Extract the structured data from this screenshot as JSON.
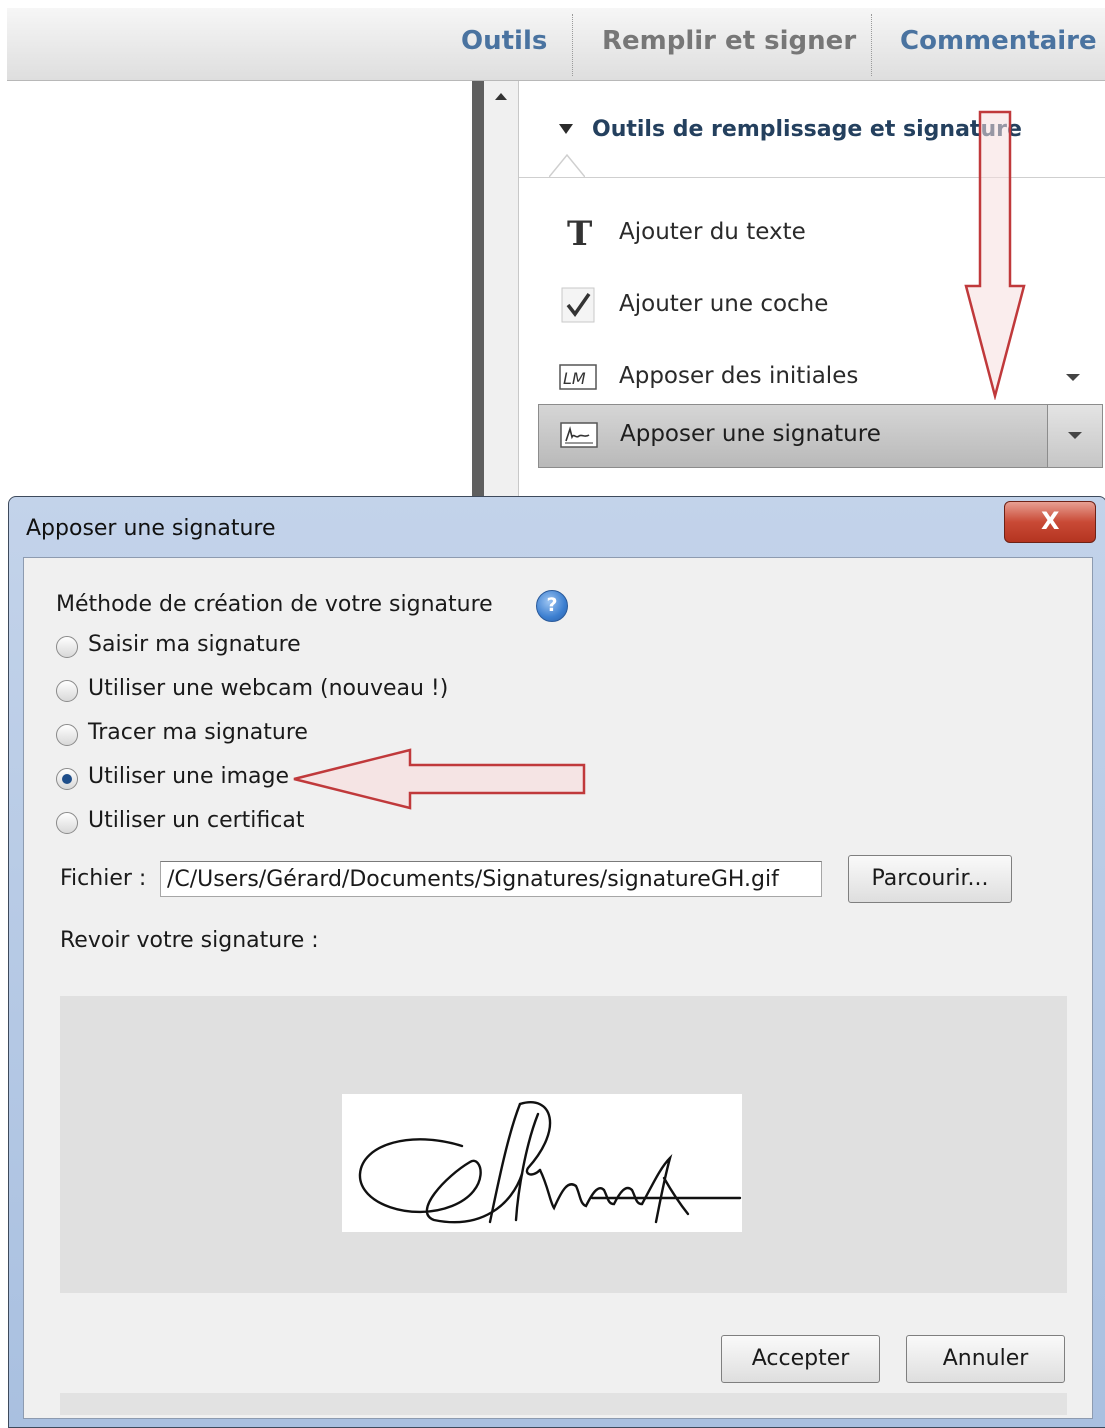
{
  "toolbar": {
    "tabs": [
      {
        "label": "Outils",
        "color": "#4a73a0"
      },
      {
        "label": "Remplir et signer",
        "color": "#777777"
      },
      {
        "label": "Commentaire",
        "color": "#4a73a0"
      }
    ]
  },
  "panel": {
    "section_title": "Outils de remplissage et signature",
    "tools": [
      {
        "label": "Ajouter du texte",
        "icon": "text-T-icon"
      },
      {
        "label": "Ajouter une coche",
        "icon": "checkmark-icon"
      },
      {
        "label": "Apposer des initiales",
        "icon": "initials-icon",
        "initials": "LM"
      },
      {
        "label": "Apposer une signature",
        "icon": "signature-pen-icon",
        "selected": true
      }
    ]
  },
  "dialog": {
    "title": "Apposer une signature",
    "close_glyph": "X",
    "method_label": "Méthode de création de votre signature",
    "help_glyph": "?",
    "options": [
      {
        "label": "Saisir ma signature",
        "selected": false
      },
      {
        "label": "Utiliser une webcam (nouveau !)",
        "selected": false
      },
      {
        "label": "Tracer ma signature",
        "selected": false
      },
      {
        "label": "Utiliser une image",
        "selected": true
      },
      {
        "label": "Utiliser un certificat",
        "selected": false
      }
    ],
    "file_label": "Fichier :",
    "file_value": "/C/Users/Gérard/Documents/Signatures/signatureGH.gif",
    "browse_label": "Parcourir...",
    "review_label": "Revoir votre signature :",
    "accept_label": "Accepter",
    "cancel_label": "Annuler"
  },
  "annotations": {
    "arrow_color": "#c0393b",
    "arrow_fill": "#f2c9c9"
  }
}
